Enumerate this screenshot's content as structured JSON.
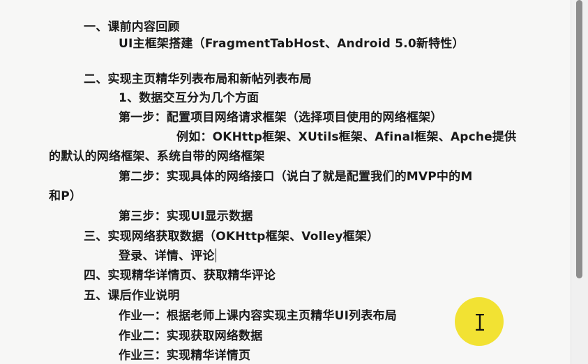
{
  "document": {
    "lines": [
      {
        "id": "section-1",
        "text": "一、课前内容回顾"
      },
      {
        "id": "section-1-detail",
        "text": "UI主框架搭建（FragmentTabHost、Android 5.0新特性）"
      },
      {
        "id": "section-2",
        "text": "二、实现主页精华列表布局和新帖列表布局"
      },
      {
        "id": "section-2-item-1",
        "text": "1、数据交互分为几个方面"
      },
      {
        "id": "step-1",
        "text": "第一步：配置项目网络请求框架（选择项目使用的网络框架）"
      },
      {
        "id": "step-1-example-a",
        "text": "例如：OKHttp框架、XUtils框架、Afinal框架、Apche提供"
      },
      {
        "id": "step-1-example-b",
        "text": "的默认的网络框架、系统自带的网络框架"
      },
      {
        "id": "step-2-a",
        "text": "第二步：实现具体的网络接口（说白了就是配置我们的MVP中的M"
      },
      {
        "id": "step-2-b",
        "text": "和P）"
      },
      {
        "id": "step-3",
        "text": "第三步：实现UI显示数据"
      },
      {
        "id": "section-3",
        "text": "三、实现网络获取数据（OKHttp框架、Volley框架）"
      },
      {
        "id": "section-3-detail",
        "text": "登录、详情、评论"
      },
      {
        "id": "section-4",
        "text": "四、实现精华详情页、获取精华评论"
      },
      {
        "id": "section-5",
        "text": "五、课后作业说明"
      },
      {
        "id": "homework-1",
        "text": "作业一：根据老师上课内容实现主页精华UI列表布局"
      },
      {
        "id": "homework-2",
        "text": "作业二：实现获取网络数据"
      },
      {
        "id": "homework-3",
        "text": "作业三：实现精华详情页"
      }
    ]
  },
  "colors": {
    "page_background": "#f7f7f6",
    "text": "#1a1a1a",
    "scrollbar_thumb": "#8d8d8d",
    "cursor_highlight": "#f2e233"
  },
  "icons": {
    "cursor": "text-cursor-icon"
  }
}
